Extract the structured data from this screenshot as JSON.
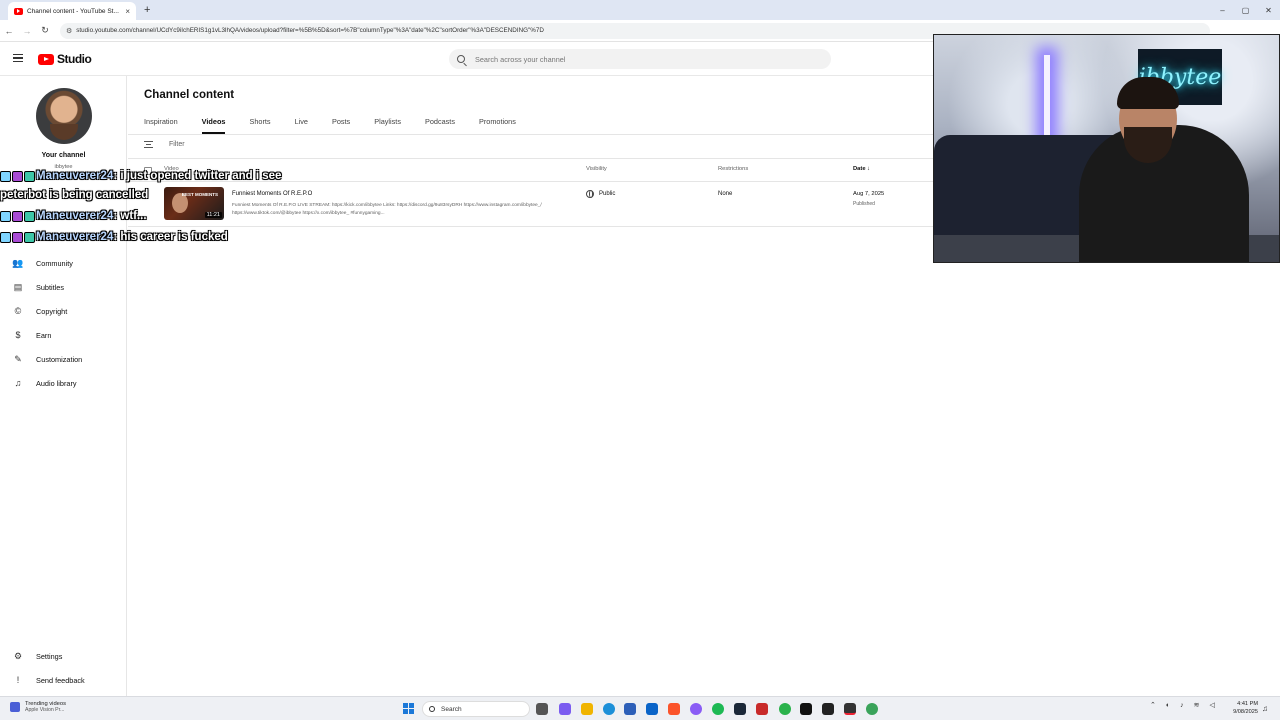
{
  "browser": {
    "tab_title": "Channel content - YouTube St...",
    "tab_close": "×",
    "new_tab": "+",
    "url": "studio.youtube.com/channel/UCdYc9iIchERIS1g1vL3lhQA/videos/upload?filter=%5B%5D&sort=%7B\"columnType\"%3A\"date\"%2C\"sortOrder\"%3A\"DESCENDING\"%7D",
    "win_min": "–",
    "win_max": "▢",
    "win_close": "✕"
  },
  "header": {
    "logo_text": "Studio",
    "search_placeholder": "Search across your channel"
  },
  "sidebar": {
    "your_channel": "Your channel",
    "handle": "ibbytee",
    "items": [
      {
        "label": "Community",
        "icon": "👥"
      },
      {
        "label": "Subtitles",
        "icon": "▤"
      },
      {
        "label": "Copyright",
        "icon": "©"
      },
      {
        "label": "Earn",
        "icon": "$"
      },
      {
        "label": "Customization",
        "icon": "✎"
      },
      {
        "label": "Audio library",
        "icon": "♫"
      }
    ],
    "settings": {
      "label": "Settings",
      "icon": "⚙"
    },
    "feedback": {
      "label": "Send feedback",
      "icon": "!"
    }
  },
  "main": {
    "title": "Channel content",
    "tabs": [
      "Inspiration",
      "Videos",
      "Shorts",
      "Live",
      "Posts",
      "Playlists",
      "Podcasts",
      "Promotions"
    ],
    "active_tab": "Videos",
    "filter_label": "Filter",
    "columns": {
      "video": "Video",
      "visibility": "Visibility",
      "restrictions": "Restrictions",
      "date": "Date ↓"
    },
    "rows": [
      {
        "title": "Funniest Moments Of R.E.P.O",
        "description": "Funniest Moments Of R.E.P.O LIVE STREAM: https://kick.com/ibbytee Links: https://discord.gg/9u83rsyDRH https://www.instagram.com/ibbytee_/ https://www.tiktok.com/@ibbytee https://x.com/ibbytee_ #funnygaming...",
        "duration": "11:21",
        "thumb_text": "BEST MOMENTS",
        "visibility": "Public",
        "restrictions": "None",
        "date": "Aug 7, 2025",
        "status": "Published"
      }
    ]
  },
  "chat": [
    {
      "user": "Maneuverer24",
      "msg": " : i just opened twitter and i see"
    },
    {
      "user": "",
      "msg": "peterbot is being cancelled"
    },
    {
      "user": "Maneuverer24",
      "msg": " : wtf..."
    },
    {
      "user": "Maneuverer24",
      "msg": " : his career is fucked"
    }
  ],
  "webcam": {
    "neon_sign": "ibbytee"
  },
  "taskbar": {
    "weather_line1": "Trending videos",
    "weather_line2": "Apple Vision Pr...",
    "search_label": "Search",
    "time": "4:41 PM",
    "date": "9/08/2025"
  },
  "colors": {
    "youtube_red": "#ff0000",
    "chat_name": "#b9d7ff",
    "neon": "#8ff3ff"
  }
}
